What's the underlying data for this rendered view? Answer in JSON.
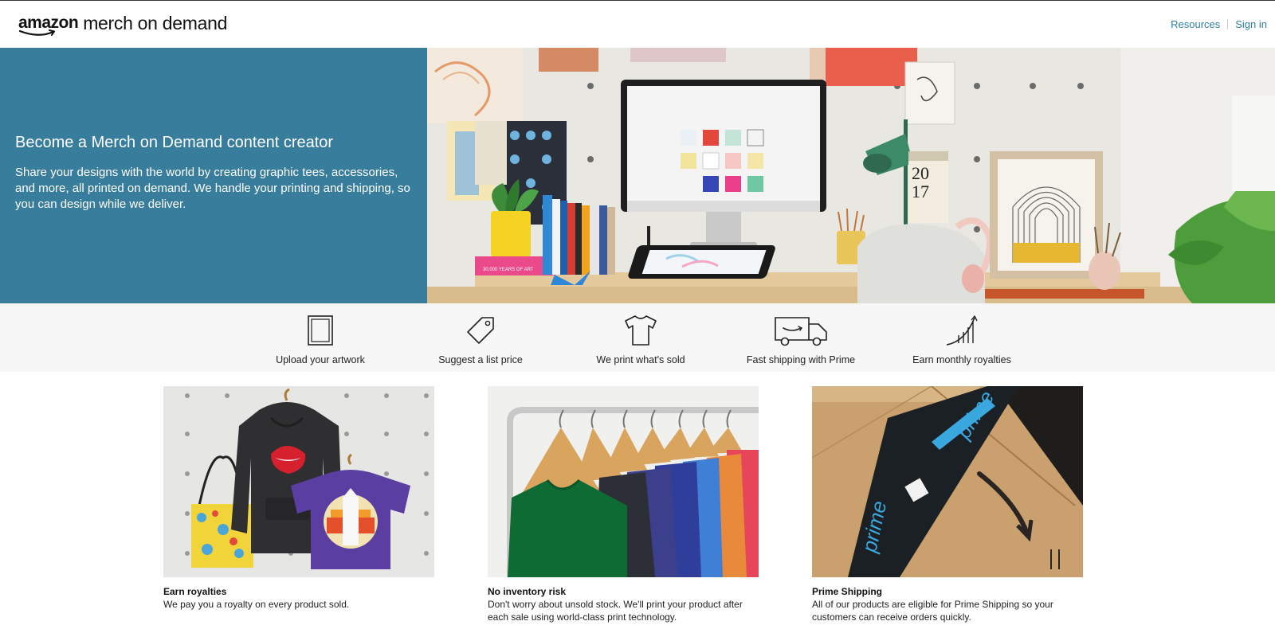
{
  "header": {
    "logo_amazon": "amazon",
    "logo_rest": "merch on demand",
    "nav": {
      "resources": "Resources",
      "sign_in": "Sign in"
    }
  },
  "hero": {
    "title": "Become a Merch on Demand content creator",
    "text": "Share your designs with the world by creating graphic tees, accessories, and more, all printed on demand. We handle your printing and shipping, so you can design while we deliver.",
    "calendar_year_top": "20",
    "calendar_year_bottom": "17",
    "book_title": "30,000 YEARS OF ART"
  },
  "steps": [
    {
      "label": "Upload your artwork",
      "icon": "frame-icon"
    },
    {
      "label": "Suggest a list price",
      "icon": "price-tag-icon"
    },
    {
      "label": "We print what's sold",
      "icon": "tshirt-icon"
    },
    {
      "label": "Fast shipping with Prime",
      "icon": "delivery-truck-icon"
    },
    {
      "label": "Earn monthly royalties",
      "icon": "growth-chart-icon"
    }
  ],
  "features": [
    {
      "title": "Earn royalties",
      "desc": "We pay you a royalty on every product sold."
    },
    {
      "title": "No inventory risk",
      "desc": "Don't worry about unsold stock. We'll print your product after each sale using world-class print technology."
    },
    {
      "title": "Prime Shipping",
      "desc": "All of our products are eligible for Prime Shipping so your customers can receive orders quickly.",
      "tape_text": "prime"
    }
  ],
  "colors": {
    "hero_bg": "#387d9c",
    "link": "#2f7f9e",
    "strip_bg": "#f7f7f7"
  }
}
